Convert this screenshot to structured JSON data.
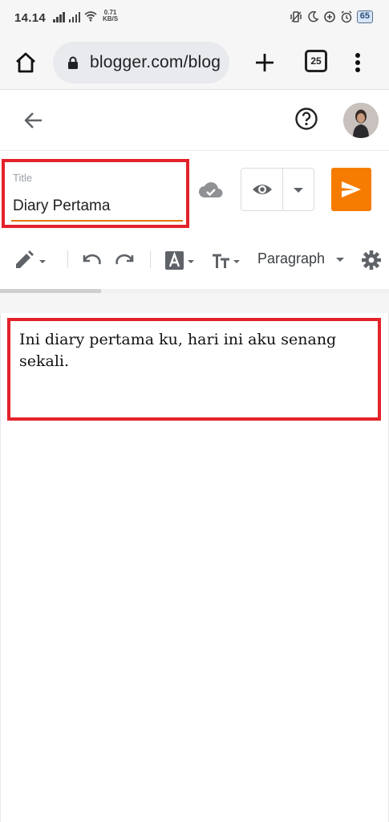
{
  "status_bar": {
    "time": "14.14",
    "speed_value": "0.71",
    "speed_unit": "KB/S",
    "battery": "65"
  },
  "browser": {
    "url": "blogger.com/blog",
    "tab_count": "25"
  },
  "editor": {
    "title_label": "Title",
    "title_value": "Diary Pertama",
    "paragraph_style": "Paragraph",
    "body_text": "Ini diary pertama ku, hari ini aku senang sekali.",
    "toolbar_progress_percent": 26
  },
  "colors": {
    "accent": "#f57c00",
    "underline": "#e8710a",
    "highlight_box": "#e3222a"
  },
  "icons": [
    "home-icon",
    "lock-icon",
    "plus-icon",
    "tabs-icon",
    "more-vert-icon",
    "back-arrow-icon",
    "help-icon",
    "avatar",
    "cloud-saved-icon",
    "eye-icon",
    "chevron-down-icon",
    "send-icon",
    "pencil-icon",
    "undo-icon",
    "redo-icon",
    "text-color-icon",
    "text-size-icon",
    "settings-gear-icon"
  ]
}
